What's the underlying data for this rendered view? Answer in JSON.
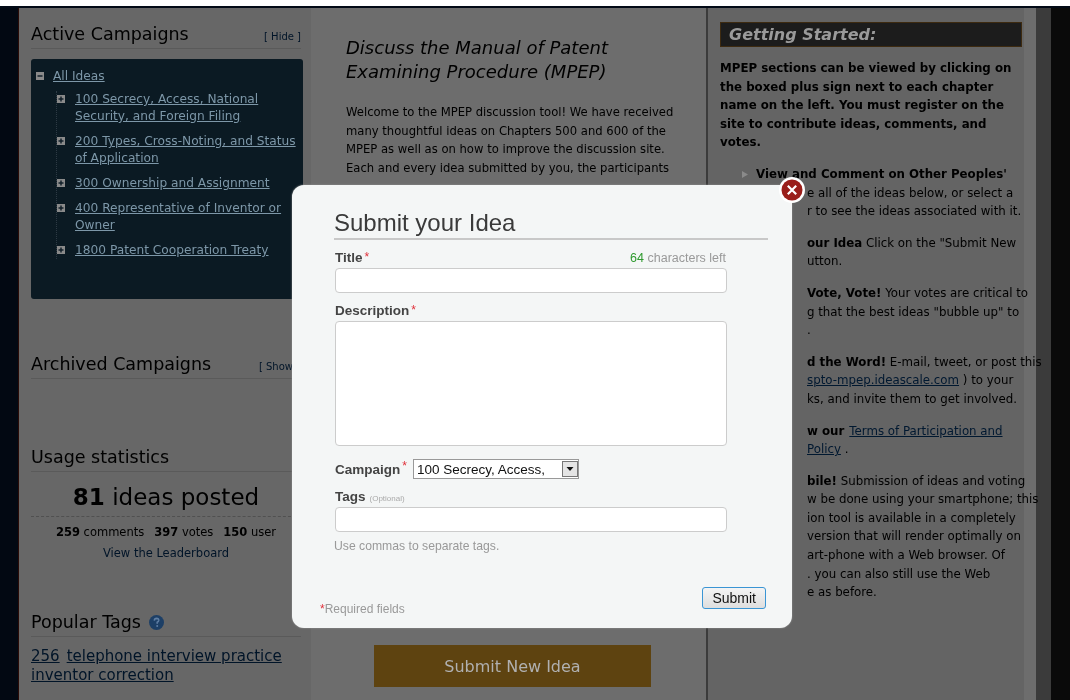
{
  "active_campaigns": {
    "heading": "Active Campaigns",
    "toggle": "[ Hide ]",
    "tree": {
      "label": "All Ideas",
      "expanded": true,
      "children": [
        {
          "label": "100 Secrecy, Access, National Security, and Foreign Filing",
          "expanded": false
        },
        {
          "label": "200 Types, Cross-Noting, and Status of Application",
          "expanded": false
        },
        {
          "label": "300 Ownership and Assignment",
          "expanded": false
        },
        {
          "label": "400 Representative of Inventor or Owner",
          "expanded": false
        },
        {
          "label": "1800 Patent Cooperation Treaty",
          "expanded": false
        }
      ]
    }
  },
  "archived_campaigns": {
    "heading": "Archived Campaigns",
    "toggle": "[ Show"
  },
  "usage_statistics": {
    "heading": "Usage statistics",
    "ideas_count": "81",
    "ideas_label": "ideas posted",
    "stats": [
      {
        "count": "259",
        "label": "comments"
      },
      {
        "count": "397",
        "label": "votes"
      },
      {
        "count": "150",
        "label": "user"
      }
    ],
    "leaderboard_link": "View the Leaderboard"
  },
  "popular_tags": {
    "heading": "Popular Tags",
    "tags": [
      "256",
      "telephone interview practice",
      "inventor correction"
    ]
  },
  "intro": {
    "heading_lines": [
      "Discuss the Manual of Patent",
      "Examining Procedure (MPEP)"
    ],
    "lines": [
      "Welcome to the MPEP discussion tool! We have received",
      "many thoughtful ideas on Chapters 500 and 600 of the",
      "MPEP as well as on how to improve the discussion site.",
      "Each and every idea submitted by you, the participants"
    ],
    "submit_button": "Submit New Idea"
  },
  "getting_started": {
    "heading": "Getting Started:",
    "intro_lines": [
      "MPEP sections can be viewed by clicking on",
      "the boxed plus sign next to each chapter",
      "name on the left. You must register on the",
      "site to contribute ideas, comments, and",
      "votes."
    ],
    "items": [
      {
        "bullet": true,
        "lines": [
          {
            "covered": false,
            "segments": [
              {
                "kind": "bold",
                "text": "View and Comment on Other Peoples'"
              }
            ]
          },
          {
            "covered": true,
            "segments": [
              {
                "kind": "plain",
                "text": "e all of the ideas below, or select a"
              }
            ]
          },
          {
            "covered": true,
            "segments": [
              {
                "kind": "plain",
                "text": "r to see the ideas associated with it."
              }
            ]
          }
        ]
      },
      {
        "bullet": false,
        "lines": [
          {
            "covered": true,
            "segments": [
              {
                "kind": "bold",
                "text": "our Idea"
              },
              {
                "kind": "plain",
                "text": " Click on the \"Submit New"
              }
            ]
          },
          {
            "covered": true,
            "segments": [
              {
                "kind": "plain",
                "text": "utton."
              }
            ]
          }
        ]
      },
      {
        "bullet": false,
        "lines": [
          {
            "covered": true,
            "segments": [
              {
                "kind": "bold",
                "text": "Vote, Vote!"
              },
              {
                "kind": "plain",
                "text": " Your votes are critical to"
              }
            ]
          },
          {
            "covered": true,
            "segments": [
              {
                "kind": "plain",
                "text": "g that the best ideas \"bubble up\" to"
              }
            ]
          },
          {
            "covered": true,
            "segments": [
              {
                "kind": "plain",
                "text": "."
              }
            ]
          }
        ]
      },
      {
        "bullet": false,
        "lines": [
          {
            "covered": true,
            "segments": [
              {
                "kind": "bold",
                "text": "d the Word!"
              },
              {
                "kind": "plain",
                "text": " E-mail, tweet, or post this"
              }
            ]
          },
          {
            "covered": true,
            "segments": [
              {
                "kind": "link",
                "text": "spto-mpep.ideascale.com"
              },
              {
                "kind": "plain",
                "text": " ) to your"
              }
            ]
          },
          {
            "covered": true,
            "segments": [
              {
                "kind": "plain",
                "text": "ks, and invite them to get involved."
              }
            ]
          }
        ]
      },
      {
        "bullet": false,
        "lines": [
          {
            "covered": true,
            "segments": [
              {
                "kind": "bold",
                "text": "w our"
              },
              {
                "kind": "link",
                "text": "Terms of Participation and"
              }
            ]
          },
          {
            "covered": true,
            "segments": [
              {
                "kind": "link",
                "text": "Policy"
              },
              {
                "kind": "plain",
                "text": " ."
              }
            ]
          }
        ]
      },
      {
        "bullet": false,
        "lines": [
          {
            "covered": true,
            "segments": [
              {
                "kind": "bold",
                "text": "bile!"
              },
              {
                "kind": "plain",
                "text": " Submission of ideas and voting"
              }
            ]
          },
          {
            "covered": true,
            "segments": [
              {
                "kind": "plain",
                "text": "w be done using your smartphone; this"
              }
            ]
          },
          {
            "covered": true,
            "segments": [
              {
                "kind": "plain",
                "text": "ion tool is available in a completely"
              }
            ]
          },
          {
            "covered": true,
            "segments": [
              {
                "kind": "plain",
                "text": "version that will render optimally on"
              }
            ]
          },
          {
            "covered": true,
            "segments": [
              {
                "kind": "plain",
                "text": "art-phone with a Web browser. Of"
              }
            ]
          },
          {
            "covered": true,
            "segments": [
              {
                "kind": "plain",
                "text": ". you can also still use the Web"
              }
            ]
          },
          {
            "covered": true,
            "segments": [
              {
                "kind": "plain",
                "text": "e as before."
              }
            ]
          }
        ]
      }
    ]
  },
  "dialog": {
    "title": "Submit your Idea",
    "required_mark": "*",
    "title_field": {
      "label": "Title",
      "required": true,
      "counter_count": "64",
      "counter_label": "characters left"
    },
    "description_field": {
      "label": "Description",
      "required": true
    },
    "campaign_field": {
      "label": "Campaign",
      "required": true,
      "value": "100 Secrecy, Access,"
    },
    "tags_field": {
      "label": "Tags",
      "required": false,
      "optional_note": "(Optional)",
      "hint": "Use commas to separate tags."
    },
    "required_note": "Required fields",
    "submit_button": "Submit"
  }
}
